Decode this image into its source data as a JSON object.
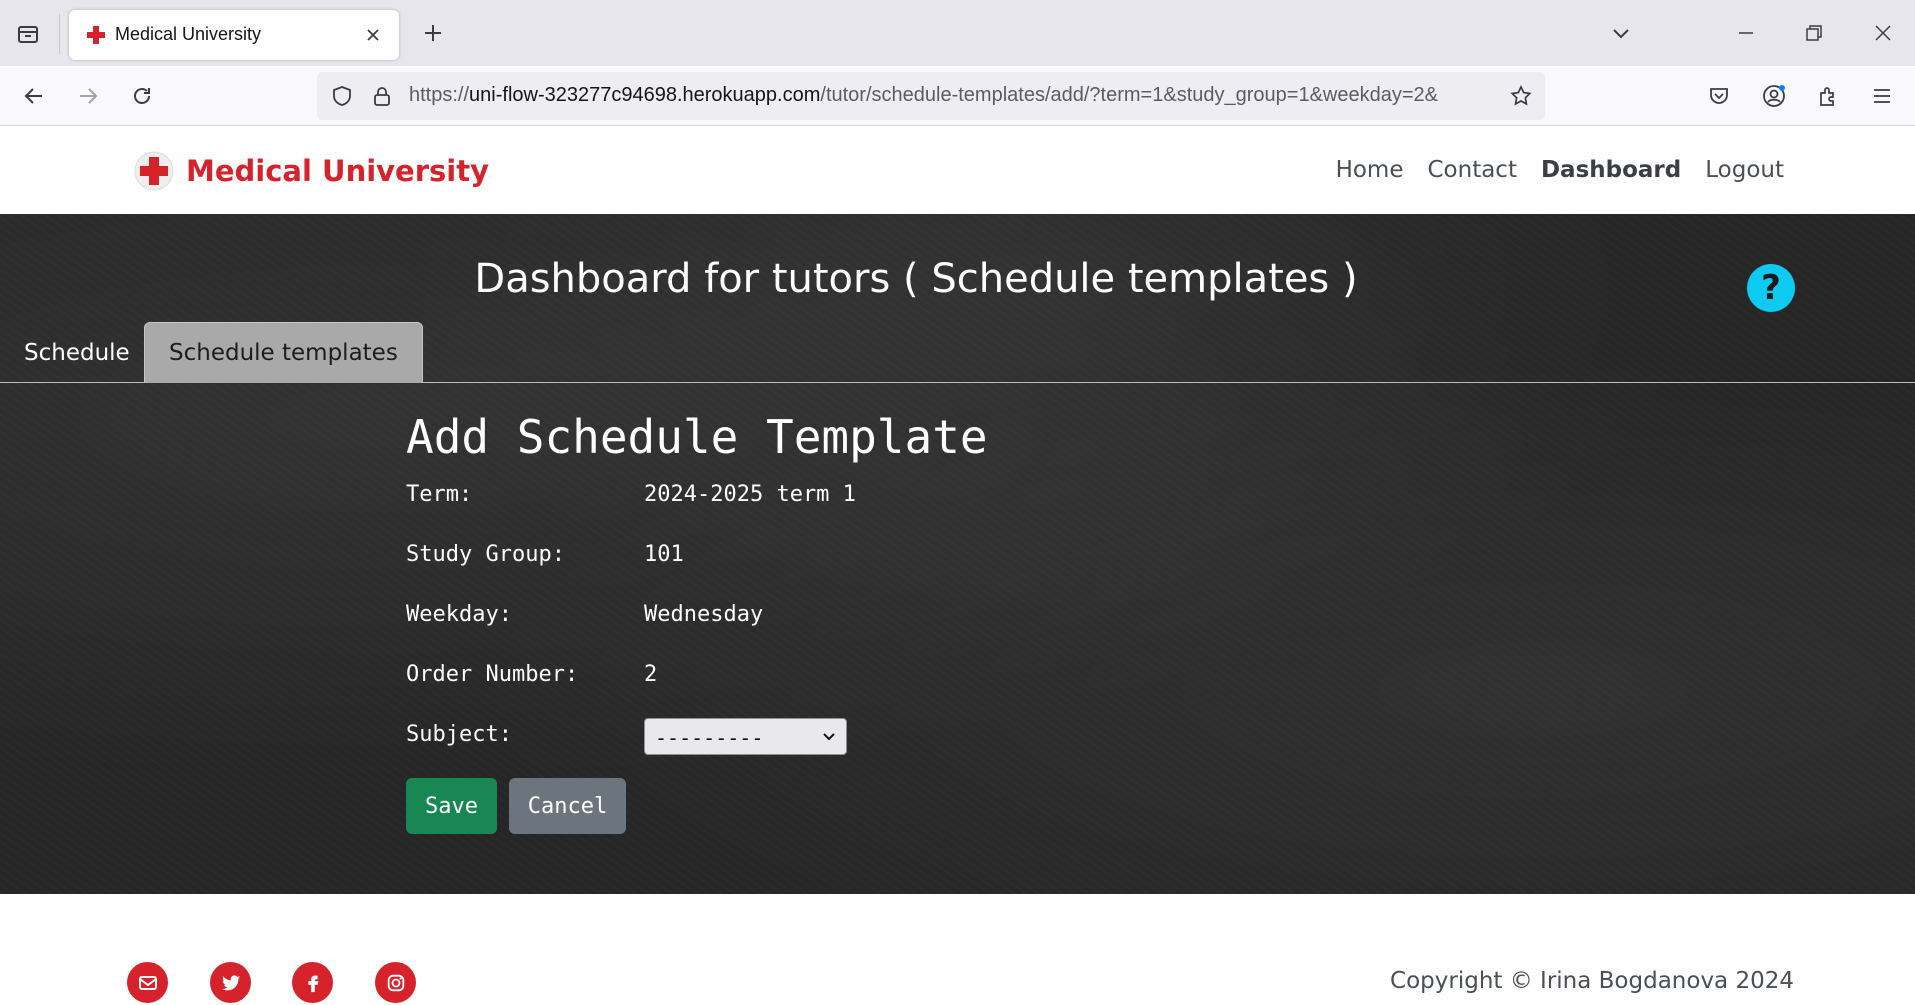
{
  "browser": {
    "tab_title": "Medical University",
    "url_prefix": "https://",
    "url_host": "uni-flow-323277c94698.herokuapp.com",
    "url_path": "/tutor/schedule-templates/add/?term=1&study_group=1&weekday=2&"
  },
  "site": {
    "brand": "Medical University",
    "nav": [
      "Home",
      "Contact",
      "Dashboard",
      "Logout"
    ],
    "active_nav": "Dashboard"
  },
  "dashboard": {
    "heading": "Dashboard for tutors ( Schedule templates )",
    "tabs": [
      "Schedule",
      "Schedule templates"
    ],
    "active_tab": "Schedule templates"
  },
  "form": {
    "title": "Add Schedule Template",
    "rows": [
      {
        "label": "Term:",
        "value": "2024-2025 term 1"
      },
      {
        "label": "Study Group:",
        "value": "101"
      },
      {
        "label": "Weekday:",
        "value": "Wednesday"
      },
      {
        "label": "Order Number:",
        "value": "2"
      }
    ],
    "subject_label": "Subject:",
    "subject_value": "---------",
    "save_label": "Save",
    "cancel_label": "Cancel"
  },
  "footer": {
    "social_icons": [
      "email-icon",
      "twitter-icon",
      "facebook-icon",
      "instagram-icon"
    ],
    "copyright": "Copyright © Irina Bogdanova 2024"
  },
  "colors": {
    "brand_red": "#d6222b",
    "help_cyan": "#0dcaf0",
    "save_green": "#198754",
    "cancel_gray": "#6c757d"
  }
}
